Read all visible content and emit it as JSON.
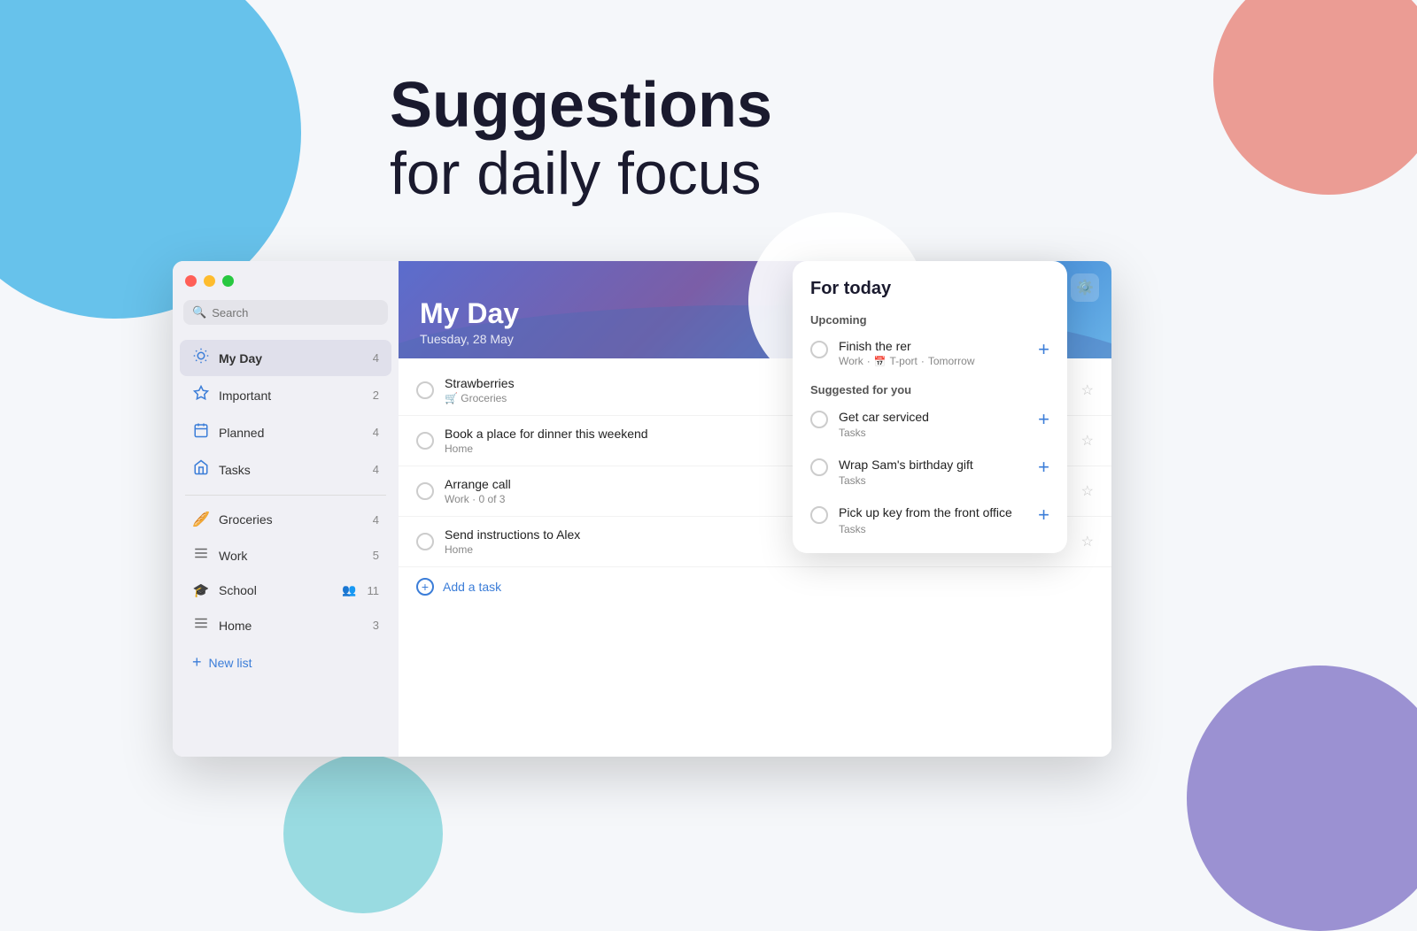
{
  "page": {
    "heading_line1": "Suggestions",
    "heading_line2": "for daily focus"
  },
  "window": {
    "traffic_lights": [
      "red",
      "yellow",
      "green"
    ]
  },
  "sidebar": {
    "search_placeholder": "Search",
    "nav_items": [
      {
        "id": "my-day",
        "icon": "☀️",
        "label": "My Day",
        "count": "4",
        "active": true
      },
      {
        "id": "important",
        "icon": "⭐",
        "label": "Important",
        "count": "2",
        "active": false
      },
      {
        "id": "planned",
        "icon": "📅",
        "label": "Planned",
        "count": "4",
        "active": false
      },
      {
        "id": "tasks",
        "icon": "🏠",
        "label": "Tasks",
        "count": "4",
        "active": false
      }
    ],
    "list_items": [
      {
        "id": "groceries",
        "icon": "🥖",
        "label": "Groceries",
        "count": "4"
      },
      {
        "id": "work",
        "icon": "≡",
        "label": "Work",
        "count": "5"
      },
      {
        "id": "school",
        "icon": "🎓",
        "label": "School",
        "count": "11",
        "shared": true
      },
      {
        "id": "home",
        "icon": "≡",
        "label": "Home",
        "count": "3"
      }
    ],
    "new_list_label": "New list"
  },
  "myday": {
    "title": "My Day",
    "date": "Tuesday, 28 May",
    "tasks": [
      {
        "id": "t1",
        "title": "Strawberries",
        "subtitle": "🛒 Groceries"
      },
      {
        "id": "t2",
        "title": "Book a place for dinner this weekend",
        "subtitle": "Home"
      },
      {
        "id": "t3",
        "title": "Arrange call",
        "subtitle": "Work · 0 of 3"
      },
      {
        "id": "t4",
        "title": "Send instructions to Alex",
        "subtitle": "Home"
      }
    ],
    "add_task_label": "Add a task"
  },
  "for_today": {
    "title": "For today",
    "upcoming_label": "Upcoming",
    "upcoming_item": {
      "title": "Finish the rer",
      "sub_list": "Work",
      "sub_extra": "T-port",
      "sub_time": "Tomorrow"
    },
    "suggested_label": "Suggested for you",
    "suggestions": [
      {
        "title": "Get car serviced",
        "sub": "Tasks"
      },
      {
        "title": "Wrap Sam's birthday gift",
        "sub": "Tasks"
      },
      {
        "title": "Pick up key from the front office",
        "sub": "Tasks"
      }
    ]
  },
  "icons": {
    "search": "🔍",
    "gear": "⚙️",
    "plus": "+",
    "star_empty": "☆",
    "calendar": "📅"
  }
}
